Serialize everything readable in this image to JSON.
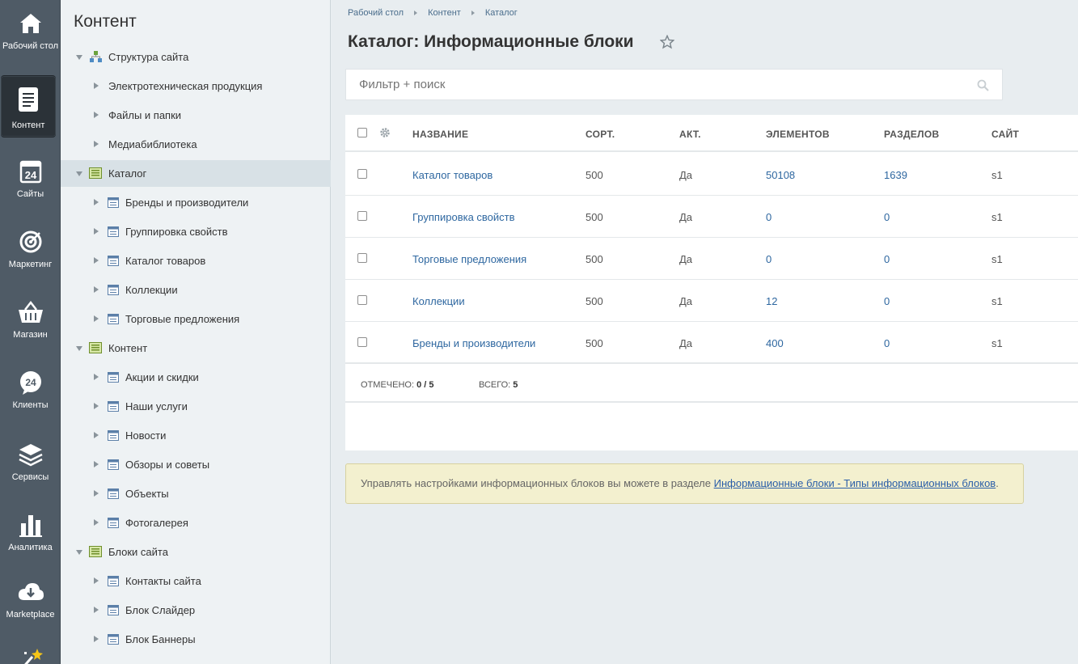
{
  "rail": {
    "items": [
      {
        "label": "Рабочий стол",
        "icon": "home-icon"
      },
      {
        "label": "Контент",
        "icon": "document-icon",
        "active": true
      },
      {
        "label": "Сайты",
        "icon": "calendar-24-icon"
      },
      {
        "label": "Маркетинг",
        "icon": "target-icon"
      },
      {
        "label": "Магазин",
        "icon": "basket-icon"
      },
      {
        "label": "Клиенты",
        "icon": "clients-24-icon"
      },
      {
        "label": "Сервисы",
        "icon": "layers-icon"
      },
      {
        "label": "Аналитика",
        "icon": "bar-chart-icon"
      },
      {
        "label": "Marketplace",
        "icon": "cloud-download-icon"
      },
      {
        "label": "",
        "icon": "magic-wand-icon"
      }
    ]
  },
  "tree": {
    "title": "Контент",
    "nodes": [
      {
        "label": "Структура сайта",
        "level": 0,
        "expanded": true,
        "icon": "site-structure-icon"
      },
      {
        "label": "Электротехническая продукция",
        "level": 1
      },
      {
        "label": "Файлы и папки",
        "level": 1
      },
      {
        "label": "Медиабиблиотека",
        "level": 1
      },
      {
        "label": "Каталог",
        "level": 0,
        "expanded": true,
        "icon": "iblock-type-icon",
        "selected": true
      },
      {
        "label": "Бренды и производители",
        "level": 2,
        "icon": "iblock-icon"
      },
      {
        "label": "Группировка свойств",
        "level": 2,
        "icon": "iblock-icon"
      },
      {
        "label": "Каталог товаров",
        "level": 2,
        "icon": "iblock-icon"
      },
      {
        "label": "Коллекции",
        "level": 2,
        "icon": "iblock-icon"
      },
      {
        "label": "Торговые предложения",
        "level": 2,
        "icon": "iblock-icon"
      },
      {
        "label": "Контент",
        "level": 0,
        "expanded": true,
        "icon": "iblock-type-icon"
      },
      {
        "label": "Акции и скидки",
        "level": 2,
        "icon": "iblock-icon"
      },
      {
        "label": "Наши услуги",
        "level": 2,
        "icon": "iblock-icon"
      },
      {
        "label": "Новости",
        "level": 2,
        "icon": "iblock-icon"
      },
      {
        "label": "Обзоры и советы",
        "level": 2,
        "icon": "iblock-icon"
      },
      {
        "label": "Объекты",
        "level": 2,
        "icon": "iblock-icon"
      },
      {
        "label": "Фотогалерея",
        "level": 2,
        "icon": "iblock-icon"
      },
      {
        "label": "Блоки сайта",
        "level": 0,
        "expanded": true,
        "icon": "iblock-type-icon"
      },
      {
        "label": "Контакты сайта",
        "level": 2,
        "icon": "iblock-icon"
      },
      {
        "label": "Блок Слайдер",
        "level": 2,
        "icon": "iblock-icon"
      },
      {
        "label": "Блок Баннеры",
        "level": 2,
        "icon": "iblock-icon"
      }
    ]
  },
  "breadcrumb": [
    "Рабочий стол",
    "Контент",
    "Каталог"
  ],
  "page_title": "Каталог: Информационные блоки",
  "filter": {
    "placeholder": "Фильтр + поиск"
  },
  "grid": {
    "columns": [
      "НАЗВАНИЕ",
      "СОРТ.",
      "АКТ.",
      "ЭЛЕМЕНТОВ",
      "РАЗДЕЛОВ",
      "САЙТ"
    ],
    "rows": [
      {
        "name": "Каталог товаров",
        "sort": "500",
        "active": "Да",
        "elements": "50108",
        "sections": "1639",
        "site": "s1"
      },
      {
        "name": "Группировка свойств",
        "sort": "500",
        "active": "Да",
        "elements": "0",
        "sections": "0",
        "site": "s1"
      },
      {
        "name": "Торговые предложения",
        "sort": "500",
        "active": "Да",
        "elements": "0",
        "sections": "0",
        "site": "s1"
      },
      {
        "name": "Коллекции",
        "sort": "500",
        "active": "Да",
        "elements": "12",
        "sections": "0",
        "site": "s1"
      },
      {
        "name": "Бренды и производители",
        "sort": "500",
        "active": "Да",
        "elements": "400",
        "sections": "0",
        "site": "s1"
      }
    ],
    "footer": {
      "selected_label": "ОТМЕЧЕНО:",
      "selected_value": "0 / 5",
      "total_label": "ВСЕГО:",
      "total_value": "5"
    }
  },
  "notice": {
    "text": "Управлять настройками информационных блоков вы можете в разделе ",
    "link": "Информационные блоки - Типы информационных блоков",
    "end": "."
  }
}
